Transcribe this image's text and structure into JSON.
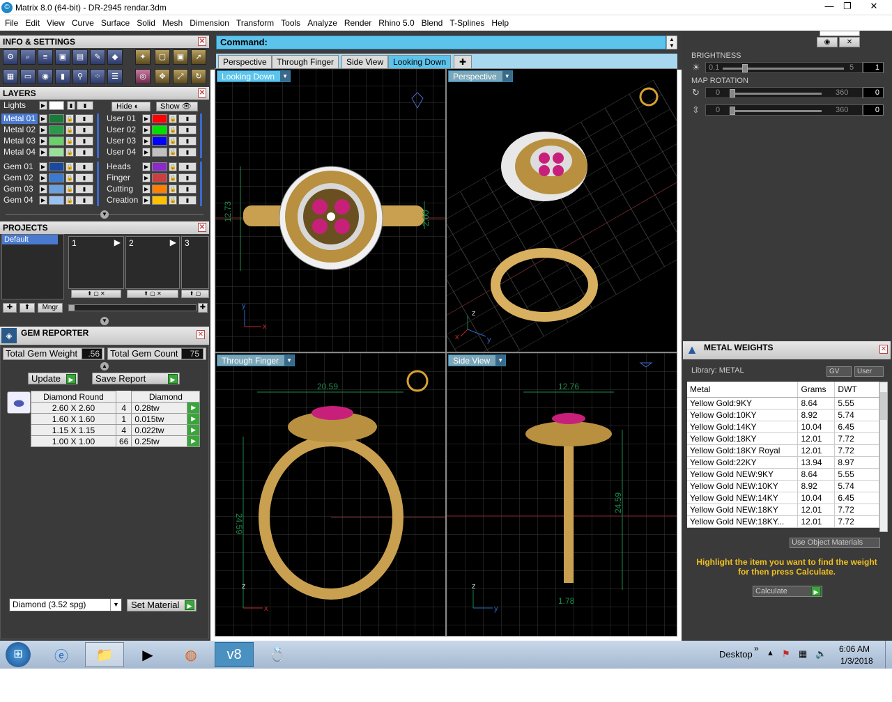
{
  "window": {
    "title": "Matrix 8.0 (64-bit) - DR-2945  rendar.3dm",
    "minimize": "—",
    "maximize": "❐",
    "close": "✕"
  },
  "menu": [
    "File",
    "Edit",
    "View",
    "Curve",
    "Surface",
    "Solid",
    "Mesh",
    "Dimension",
    "Transform",
    "Tools",
    "Analyze",
    "Render",
    "Rhino 5.0",
    "Blend",
    "T-Splines",
    "Help"
  ],
  "info_settings": {
    "title": "INFO & SETTINGS"
  },
  "layers": {
    "title": "LAYERS",
    "lights": "Lights",
    "hide": "Hide",
    "show": "Show",
    "left": [
      {
        "name": "Metal 01",
        "color": "#1a7a3a"
      },
      {
        "name": "Metal 02",
        "color": "#2a9a4a"
      },
      {
        "name": "Metal 03",
        "color": "#6ad06a"
      },
      {
        "name": "Metal 04",
        "color": "#9ae09a"
      },
      {
        "name": "Gem 01",
        "color": "#1a4aa0"
      },
      {
        "name": "Gem 02",
        "color": "#3a7ad0"
      },
      {
        "name": "Gem 03",
        "color": "#6aa0e0"
      },
      {
        "name": "Gem 04",
        "color": "#9ac0f0"
      }
    ],
    "right": [
      {
        "name": "User 01",
        "color": "#ff0000"
      },
      {
        "name": "User 02",
        "color": "#00e000"
      },
      {
        "name": "User 03",
        "color": "#0000ff"
      },
      {
        "name": "User 04",
        "color": "#c0c0c0"
      },
      {
        "name": "Heads",
        "color": "#8a2ac8"
      },
      {
        "name": "Finger",
        "color": "#c84040"
      },
      {
        "name": "Cutting",
        "color": "#ff8000"
      },
      {
        "name": "Creation",
        "color": "#ffc000"
      }
    ]
  },
  "projects": {
    "title": "PROJECTS",
    "default": "Default",
    "slots": [
      "1",
      "2",
      "3"
    ],
    "mngr": "Mngr"
  },
  "gem_reporter": {
    "title": "GEM REPORTER",
    "weight_label": "Total Gem Weight",
    "weight": ".56",
    "count_label": "Total Gem Count",
    "count": "75",
    "update": "Update",
    "save": "Save Report",
    "header": [
      "Diamond Round",
      "",
      "Diamond"
    ],
    "rows": [
      [
        "2.60 X 2.60",
        "4",
        "0.28tw"
      ],
      [
        "1.60 X 1.60",
        "1",
        "0.015tw"
      ],
      [
        "1.15 X 1.15",
        "4",
        "0.022tw"
      ],
      [
        "1.00 X 1.00",
        "66",
        "0.25tw"
      ]
    ],
    "material": "Diamond    (3.52 spg)",
    "set_material": "Set Material"
  },
  "command": {
    "label": "Command:"
  },
  "tabs": [
    "Perspective",
    "Through Finger",
    "Side View",
    "Looking Down"
  ],
  "viewports": {
    "top_left": "Looking Down",
    "top_right": "Perspective",
    "bottom_left": "Through Finger",
    "bottom_right": "Side View",
    "dims": {
      "tl_v": "12.73",
      "tl_h": "2.00",
      "bl_w": "20.59",
      "bl_h": "24.59",
      "br_w": "12.76",
      "br_h": "24.59",
      "br_b": "1.78"
    },
    "axes": {
      "x": "x",
      "y": "y",
      "z": "z"
    }
  },
  "display": {
    "brightness_label": "BRIGHTNESS",
    "brightness_min": "0.1",
    "brightness_max": "5",
    "brightness_val": "1",
    "map_label": "MAP ROTATION",
    "map_min": "0",
    "map_max": "360",
    "map_val1": "0",
    "map_val2": "0"
  },
  "metal_weights": {
    "title": "METAL WEIGHTS",
    "library": "Library: METAL",
    "gv": "GV",
    "user": "User",
    "columns": [
      "Metal",
      "Grams",
      "DWT"
    ],
    "rows": [
      [
        "Yellow Gold:9KY",
        "8.64",
        "5.55"
      ],
      [
        "Yellow Gold:10KY",
        "8.92",
        "5.74"
      ],
      [
        "Yellow Gold:14KY",
        "10.04",
        "6.45"
      ],
      [
        "Yellow Gold:18KY",
        "12.01",
        "7.72"
      ],
      [
        "Yellow Gold:18KY Royal",
        "12.01",
        "7.72"
      ],
      [
        "Yellow Gold:22KY",
        "13.94",
        "8.97"
      ],
      [
        "Yellow Gold NEW:9KY",
        "8.64",
        "5.55"
      ],
      [
        "Yellow Gold NEW:10KY",
        "8.92",
        "5.74"
      ],
      [
        "Yellow Gold NEW:14KY",
        "10.04",
        "6.45"
      ],
      [
        "Yellow Gold NEW:18KY",
        "12.01",
        "7.72"
      ],
      [
        "Yellow Gold NEW:18KY...",
        "12.01",
        "7.72"
      ]
    ],
    "use_obj": "Use Object Materials",
    "hint": "Highlight the item you want to find the weight for then press Calculate.",
    "calculate": "Calculate"
  },
  "taskbar": {
    "desktop": "Desktop",
    "chevron": "»",
    "time": "6:06 AM",
    "date": "1/3/2018"
  }
}
